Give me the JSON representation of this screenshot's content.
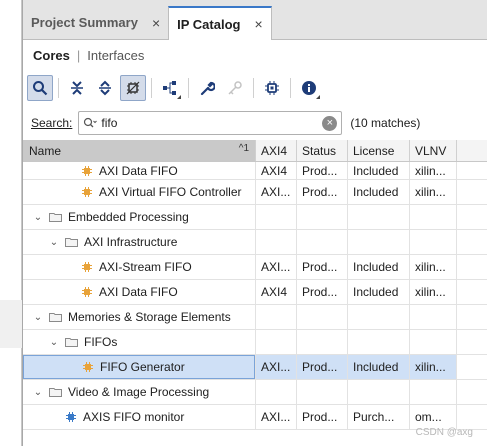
{
  "tabs": [
    {
      "label": "Project Summary",
      "active": false
    },
    {
      "label": "IP Catalog",
      "active": true
    }
  ],
  "tab_close_glyph": "×",
  "subtabs": {
    "cores": "Cores",
    "separator": "|",
    "interfaces": "Interfaces"
  },
  "toolbar": [
    "search-icon",
    "collapse-all-icon",
    "expand-all-icon",
    "filter-icon",
    "hierarchy-icon",
    "wrench-icon",
    "key-icon",
    "chip-icon",
    "info-icon"
  ],
  "search": {
    "label": "Search:",
    "value": "fifo",
    "matches": "(10 matches)"
  },
  "columns": {
    "name": "Name",
    "sort": "1",
    "axi4": "AXI4",
    "status": "Status",
    "license": "License",
    "vlnv": "VLNV"
  },
  "rows": [
    {
      "indent": 3,
      "type": "ip",
      "name": "AXI Data FIFO",
      "axi4": "AXI4",
      "status": "Prod...",
      "license": "Included",
      "vlnv": "xilin..."
    },
    {
      "indent": 3,
      "type": "ip",
      "name": "AXI Virtual FIFO Controller",
      "axi4": "AXI...",
      "status": "Prod...",
      "license": "Included",
      "vlnv": "xilin..."
    },
    {
      "indent": 1,
      "type": "folder",
      "name": "Embedded Processing",
      "axi4": "",
      "status": "",
      "license": "",
      "vlnv": ""
    },
    {
      "indent": 2,
      "type": "folder",
      "name": "AXI Infrastructure",
      "axi4": "",
      "status": "",
      "license": "",
      "vlnv": ""
    },
    {
      "indent": 3,
      "type": "ip",
      "name": "AXI-Stream FIFO",
      "axi4": "AXI...",
      "status": "Prod...",
      "license": "Included",
      "vlnv": "xilin..."
    },
    {
      "indent": 3,
      "type": "ip",
      "name": "AXI Data FIFO",
      "axi4": "AXI4",
      "status": "Prod...",
      "license": "Included",
      "vlnv": "xilin..."
    },
    {
      "indent": 1,
      "type": "folder",
      "name": "Memories & Storage Elements",
      "axi4": "",
      "status": "",
      "license": "",
      "vlnv": ""
    },
    {
      "indent": 2,
      "type": "folder",
      "name": "FIFOs",
      "axi4": "",
      "status": "",
      "license": "",
      "vlnv": ""
    },
    {
      "indent": 3,
      "type": "ip",
      "name": "FIFO Generator",
      "axi4": "AXI...",
      "status": "Prod...",
      "license": "Included",
      "vlnv": "xilin...",
      "selected": true
    },
    {
      "indent": 1,
      "type": "folder",
      "name": "Video & Image Processing",
      "axi4": "",
      "status": "",
      "license": "",
      "vlnv": ""
    },
    {
      "indent": 2,
      "type": "ip-blue",
      "name": "AXIS FIFO monitor",
      "axi4": "AXI...",
      "status": "Prod...",
      "license": "Purch...",
      "vlnv": "om..."
    }
  ],
  "colors": {
    "accent": "#3a78c8",
    "selection": "#cfe0f6",
    "ip_orange": "#e8a33a",
    "ip_blue": "#3a7ac8"
  },
  "watermark": "CSDN @axg"
}
